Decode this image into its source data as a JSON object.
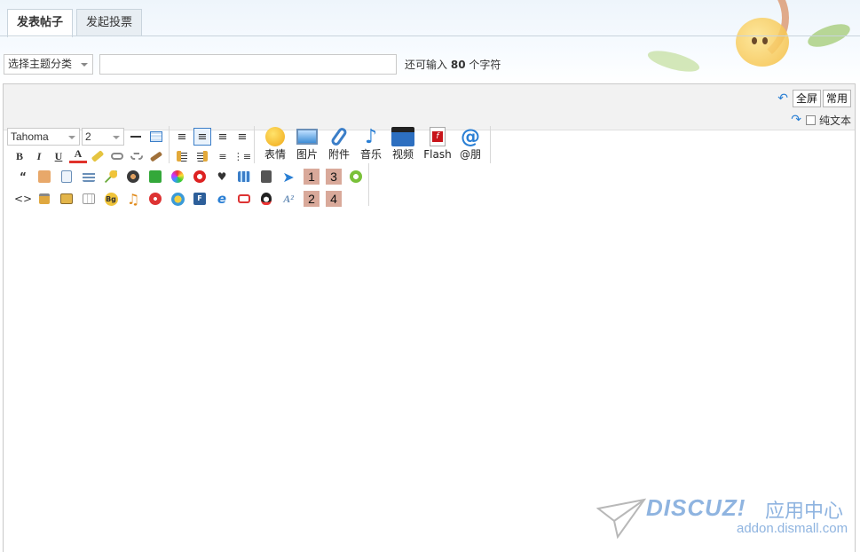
{
  "tabs": [
    {
      "label": "发表帖子",
      "active": true
    },
    {
      "label": "发起投票",
      "active": false
    }
  ],
  "subject": {
    "category_value": "选择主题分类",
    "input_value": "",
    "hint_prefix": "还可输入",
    "hint_count": "80",
    "hint_suffix": "个字符"
  },
  "editor": {
    "fullscreen_label": "全屏",
    "common_label": "常用",
    "plain_text_label": "纯文本",
    "font_family_value": "Tahoma",
    "font_size_value": "2",
    "big_buttons": [
      {
        "label": "表情",
        "icon": "smiley-icon"
      },
      {
        "label": "图片",
        "icon": "image-icon"
      },
      {
        "label": "附件",
        "icon": "paperclip-icon"
      },
      {
        "label": "音乐",
        "icon": "music-note-icon"
      },
      {
        "label": "视频",
        "icon": "video-icon"
      },
      {
        "label": "Flash",
        "icon": "flash-icon"
      },
      {
        "label": "@朋",
        "icon": "at-icon"
      }
    ],
    "format_buttons": {
      "bold": "B",
      "italic": "I",
      "underline": "U",
      "font_color": "A",
      "quote": "“",
      "code": "<>"
    },
    "number_badges": [
      "1",
      "3",
      "2",
      "4"
    ]
  },
  "watermark": {
    "brand": "DISCUZ!",
    "cn": "应用中心",
    "url": "addon.dismall.com"
  },
  "colors": {
    "accent_blue": "#2a7fd4",
    "badge_bg": "#d9a99a",
    "border": "#c9c9c9",
    "watermark": "#8fb4e0"
  }
}
